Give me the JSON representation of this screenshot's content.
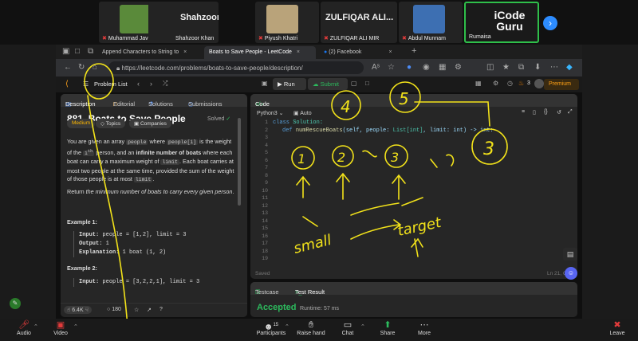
{
  "gallery": {
    "participants": [
      {
        "big": "",
        "label": "Muhammad Javed",
        "muted": true
      },
      {
        "big": "Shahzoor Khan",
        "label": "Shahzoor Khan",
        "muted": false
      },
      {
        "big": "",
        "label": "Piyush Khatri",
        "muted": true
      },
      {
        "big": "ZULFIQAR ALI...",
        "label": "ZULFIQAR ALI MIR",
        "muted": true
      },
      {
        "big": "",
        "label": "Abdul Munnam",
        "muted": true
      },
      {
        "big": "",
        "label": "Rumaisa",
        "muted": false
      }
    ],
    "logo_line1": "iCode",
    "logo_line2": "Guru",
    "accent": "#2fbf4a"
  },
  "browser": {
    "tabs": [
      {
        "label": "Append Characters to String to"
      },
      {
        "label": "Boats to Save People - LeetCode"
      },
      {
        "label": "(2) Facebook"
      }
    ],
    "url": "https://leetcode.com/problems/boats-to-save-people/description/"
  },
  "leetcode": {
    "problem_list": "Problem List",
    "run": "Run",
    "submit": "Submit",
    "streak": "3",
    "premium": "Premium",
    "left_tabs": [
      "Description",
      "Editorial",
      "Solutions",
      "Submissions"
    ],
    "title": "881. Boats to Save People",
    "solved": "Solved",
    "tags": [
      "Medium",
      "Topics",
      "Companies"
    ],
    "para1_a": "You are given an array",
    "para1_people": "people",
    "para1_b": "where",
    "para1_peoplei": "people[i]",
    "para1_c": "is the weight",
    "para1_d": "of the",
    "para1_ith": "i",
    "para1_th": "th",
    "para1_e": "person, and an",
    "para1_f": "infinite number of boats",
    "para1_g": "where each boat can carry a maximum weight of",
    "para1_limit": "limit",
    "para1_h": ". Each boat carries at most two people at the same time, provided the sum of the weight of those people is at most",
    "para1_limit2": "limit",
    "para1_i": ".",
    "para2_a": "Return",
    "para2_em": "the minimum number of boats to carry every given person",
    "para2_b": ".",
    "ex1_title": "Example 1:",
    "ex1_input_label": "Input:",
    "ex1_input": "people = [1,2], limit = 3",
    "ex1_output_label": "Output:",
    "ex1_output": "1",
    "ex1_expl_label": "Explanation:",
    "ex1_expl": "1 boat (1, 2)",
    "ex2_title": "Example 2:",
    "ex2_input_label": "Input:",
    "ex2_input": "people = [3,2,2,1], limit = 3",
    "likes": "6.4K",
    "comments": "180",
    "code_tab": "Code",
    "language": "Python3",
    "auto": "Auto",
    "code_line1_kw": "class",
    "code_line1_name": "Solution:",
    "code_line2_def": "def",
    "code_line2_fn": "numRescueBoats",
    "code_line2_rest1": "(self, people: ",
    "code_line2_ty": "List[int]",
    "code_line2_rest2": ", limit: int) -> int:",
    "line_numbers": [
      "1",
      "2",
      "3",
      "4",
      "5",
      "6",
      "7",
      "8",
      "9",
      "10",
      "11",
      "12",
      "13",
      "14",
      "15",
      "16",
      "17",
      "18",
      "19"
    ],
    "saved": "Saved",
    "cursor_pos": "Ln 21, C",
    "testcase": "Testcase",
    "test_result": "Test Result",
    "accepted": "Accepted",
    "runtime": "Runtime: 57 ms"
  },
  "zoom": {
    "audio": "Audio",
    "video": "Video",
    "participants": "Participants",
    "participant_count": "15",
    "raise_hand": "Raise hand",
    "chat": "Chat",
    "share": "Share",
    "more": "More",
    "leave": "Leave"
  },
  "annotations": {
    "circled": [
      "1",
      "2",
      "3",
      "4",
      "5",
      "3"
    ],
    "words": [
      "small",
      "target"
    ]
  }
}
